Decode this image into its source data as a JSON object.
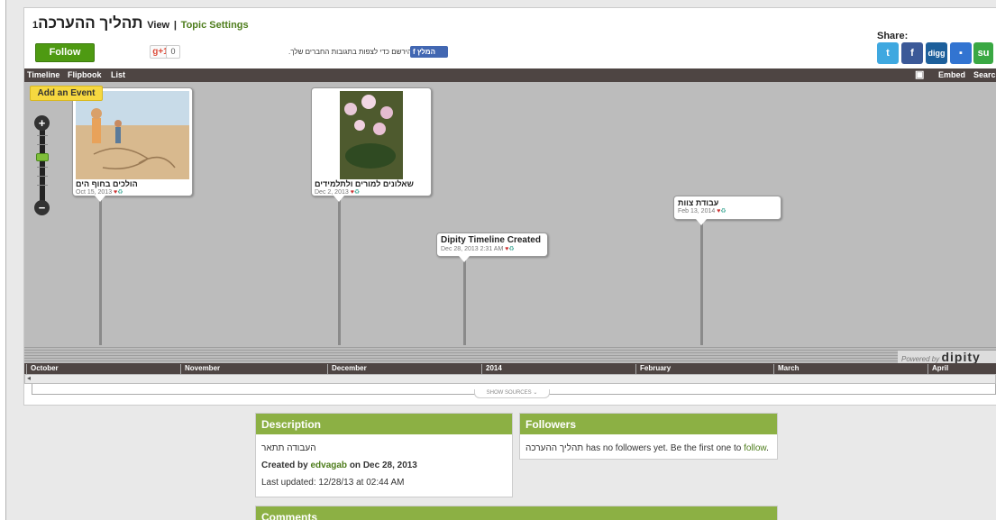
{
  "header": {
    "title": "תהליך ההערכה",
    "title_suffix": "1",
    "view_label": "View",
    "separator": "|",
    "topic_settings_label": "Topic Settings",
    "follow_label": "Follow",
    "gplus_label": "g+1",
    "gplus_count": "0",
    "fb_note": "הירשם כדי לצפות בתגובות החברים שלך.",
    "fb_button_label": "המלץ",
    "share_label": "Share:",
    "share_icons": [
      "twitter-icon",
      "facebook-icon",
      "digg-icon",
      "delicious-icon",
      "stumbleupon-icon"
    ]
  },
  "timeline_bar": {
    "tabs": [
      "Timeline",
      "Flipbook",
      "List"
    ],
    "embed_label": "Embed",
    "search_label": "Search"
  },
  "add_event_label": "Add an Event",
  "zoom": {
    "plus": "+",
    "minus": "−"
  },
  "events": [
    {
      "title": "הולכים בחוף הים",
      "date": "Oct 15, 2013",
      "has_photo": true,
      "photo": "beach"
    },
    {
      "title": "שאלונים למורים ולתלמידים",
      "date": "Dec 2, 2013",
      "has_photo": true,
      "photo": "flowers"
    },
    {
      "title": "Dipity Timeline Created",
      "date": "Dec 28, 2013 2:31 AM",
      "has_photo": false
    },
    {
      "title": "עבודת צוות",
      "date": "Feb 13, 2014",
      "has_photo": false
    }
  ],
  "powered_by": {
    "prefix": "Powered by",
    "brand": "dipity"
  },
  "months": [
    "October",
    "November",
    "December",
    "2014",
    "February",
    "March",
    "April"
  ],
  "show_sources_label": "SHOW SOURCES",
  "description": {
    "heading": "Description",
    "text": "העבודה תתאר",
    "created_prefix": "Created by",
    "created_user": "edvagab",
    "created_suffix": "on Dec 28, 2013",
    "updated": "Last updated: 12/28/13 at 02:44 AM"
  },
  "followers": {
    "heading": "Followers",
    "text": "תהליך ההערכה has no followers yet. Be the first one to",
    "follow_link": "follow",
    "end": "."
  },
  "comments": {
    "heading": "Comments"
  },
  "colors": {
    "accent": "#8cb044",
    "follow": "#4e9a12",
    "dark_bar": "#4e4543",
    "add_event": "#f6d840"
  }
}
